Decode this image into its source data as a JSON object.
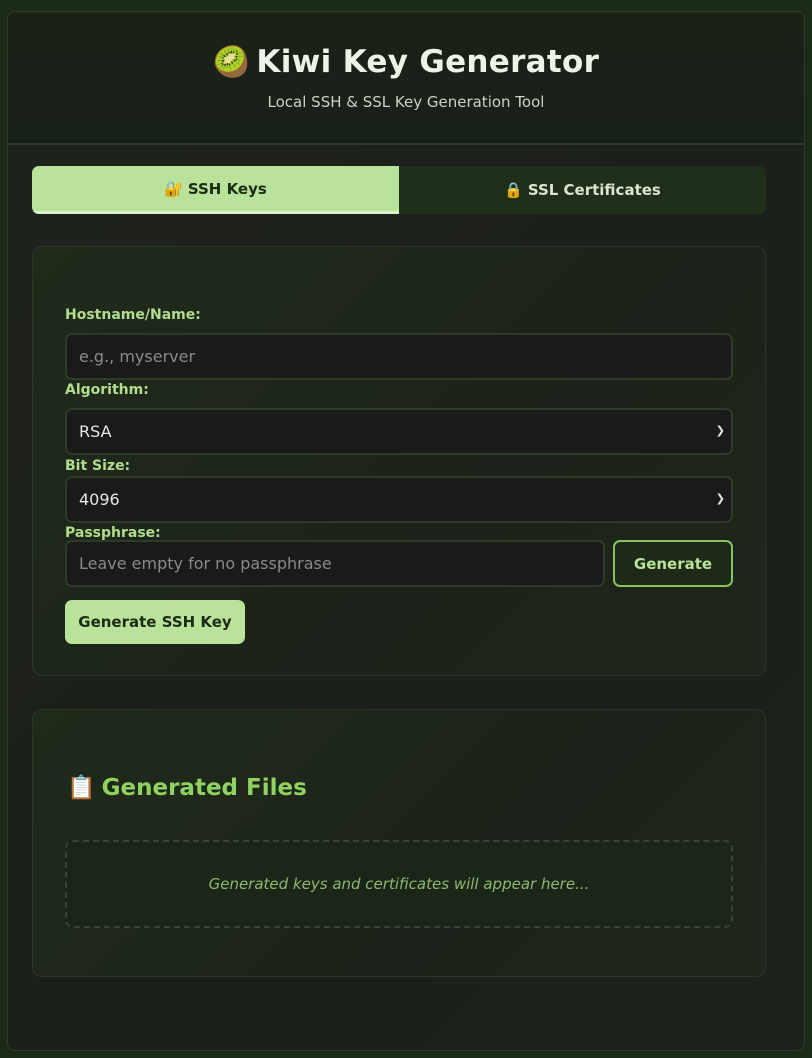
{
  "header": {
    "title_icon": "🥝",
    "title": "Kiwi Key Generator",
    "subtitle": "Local SSH & SSL Key Generation Tool"
  },
  "tabs": [
    {
      "icon": "🔐",
      "label": "SSH Keys",
      "active": true
    },
    {
      "icon": "🔒",
      "label": "SSL Certificates",
      "active": false
    }
  ],
  "form": {
    "hostname": {
      "label": "Hostname/Name:",
      "value": "",
      "placeholder": "e.g., myserver"
    },
    "algorithm": {
      "label": "Algorithm:",
      "selected": "RSA"
    },
    "bit_size": {
      "label": "Bit Size:",
      "selected": "4096"
    },
    "passphrase": {
      "label": "Passphrase:",
      "value": "",
      "placeholder": "Leave empty for no passphrase"
    },
    "generate_passphrase_label": "Generate",
    "submit_label": "Generate SSH Key"
  },
  "files": {
    "icon": "📋",
    "title": "Generated Files",
    "empty_text": "Generated keys and certificates will appear here..."
  },
  "colors": {
    "accent": "#b9e39b",
    "accent_dark": "#86c45a",
    "label": "#b2dd8d",
    "background": "#1f221d"
  }
}
